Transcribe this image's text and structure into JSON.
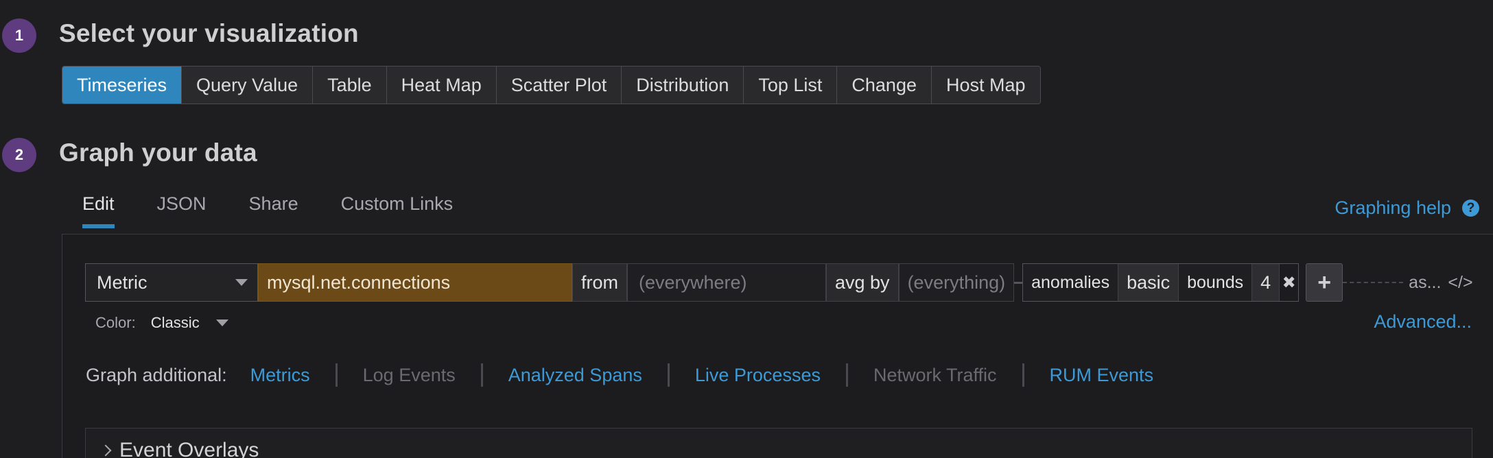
{
  "step1": {
    "number": "1",
    "title": "Select your visualization"
  },
  "viz_tabs": [
    {
      "label": "Timeseries",
      "active": true
    },
    {
      "label": "Query Value"
    },
    {
      "label": "Table"
    },
    {
      "label": "Heat Map"
    },
    {
      "label": "Scatter Plot"
    },
    {
      "label": "Distribution"
    },
    {
      "label": "Top List"
    },
    {
      "label": "Change"
    },
    {
      "label": "Host Map"
    }
  ],
  "step2": {
    "number": "2",
    "title": "Graph your data"
  },
  "edit_tabs": [
    {
      "label": "Edit",
      "active": true
    },
    {
      "label": "JSON"
    },
    {
      "label": "Share"
    },
    {
      "label": "Custom Links"
    }
  ],
  "help": {
    "label": "Graphing help",
    "icon": "question-circle-icon",
    "icon_glyph": "?"
  },
  "query": {
    "source_type": "Metric",
    "metric": "mysql.net.connections",
    "from_label": "from",
    "from_placeholder": "(everywhere)",
    "agg_label": "avg by",
    "agg_placeholder": "(everything)",
    "function": {
      "name": "anomalies",
      "args": [
        "basic",
        "bounds",
        "4"
      ]
    },
    "close_glyph": "✖",
    "add_glyph": "+",
    "alias_label": "as...",
    "code_glyph": "</>"
  },
  "color": {
    "label": "Color:",
    "value": "Classic"
  },
  "advanced_label": "Advanced...",
  "graph_additional": {
    "label": "Graph additional:",
    "items": [
      {
        "label": "Metrics",
        "enabled": true
      },
      {
        "label": "Log Events",
        "enabled": false
      },
      {
        "label": "Analyzed Spans",
        "enabled": true
      },
      {
        "label": "Live Processes",
        "enabled": true
      },
      {
        "label": "Network Traffic",
        "enabled": false
      },
      {
        "label": "RUM Events",
        "enabled": true
      }
    ]
  },
  "event_overlays": {
    "label": "Event Overlays"
  },
  "colors": {
    "accent": "#2f86bd",
    "link": "#3d9ad6",
    "badge": "#5f3b80",
    "metric_bg": "#6b4a17",
    "background": "#1e1e21"
  }
}
